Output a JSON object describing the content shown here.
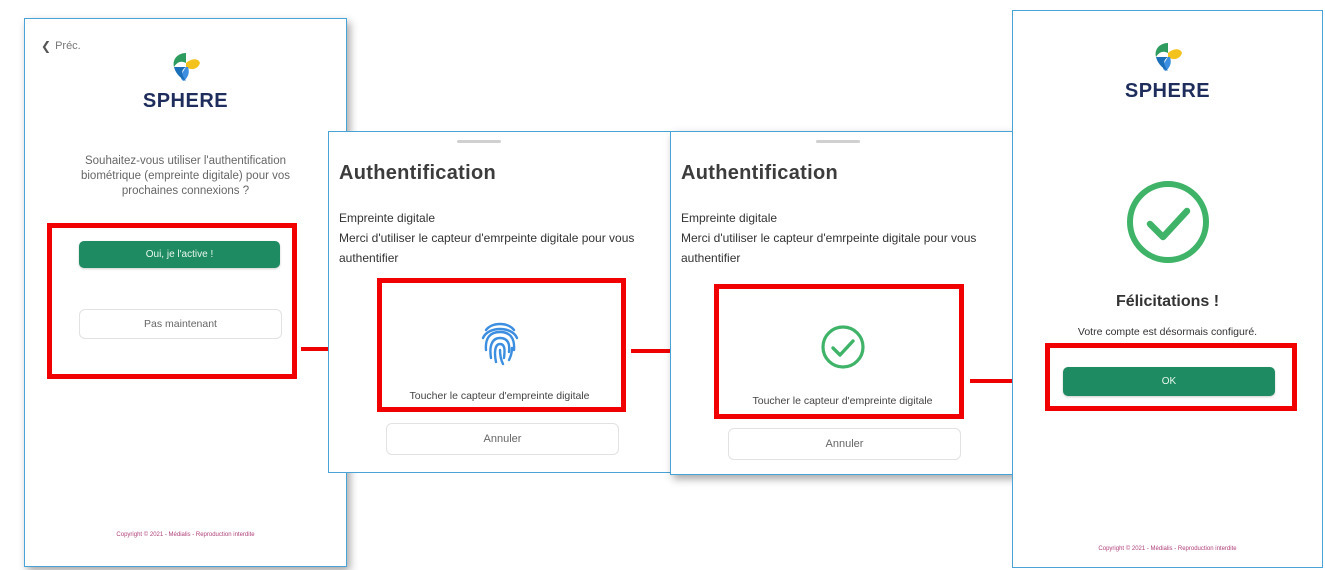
{
  "screen1": {
    "back_label": "Préc.",
    "brand": "SPHERE",
    "question": "Souhaitez-vous utiliser l'authentification biométrique (empreinte digitale) pour vos prochaines connexions ?",
    "primary_button": "Oui, je l'active !",
    "secondary_button": "Pas maintenant",
    "copyright": "Copyright © 2021 - Médialis - Reproduction interdite"
  },
  "screen2": {
    "title": "Authentification",
    "line1": "Empreinte digitale",
    "line2": "Merci d'utiliser le capteur d'emrpeinte digitale pour vous authentifier",
    "touch_label": "Toucher le capteur d'empreinte digitale",
    "cancel_button": "Annuler"
  },
  "screen3": {
    "title": "Authentification",
    "line1": "Empreinte digitale",
    "line2": "Merci d'utiliser le capteur d'emrpeinte digitale pour vous authentifier",
    "touch_label": "Toucher le capteur d'empreinte digitale",
    "cancel_button": "Annuler"
  },
  "screen4": {
    "brand": "SPHERE",
    "heading": "Félicitations !",
    "message": "Votre compte est désormais configuré.",
    "ok_button": "OK",
    "copyright": "Copyright © 2021 - Médialis - Reproduction interdite"
  },
  "colors": {
    "accent_green": "#1f8b62",
    "highlight_red": "#f00000",
    "panel_border": "#4aa3d6",
    "brand_navy": "#1f2d5c",
    "fingerprint_blue": "#3b8ee0"
  },
  "icons": {
    "logo": "sphere-logo",
    "fingerprint": "fingerprint-icon",
    "check": "check-circle-icon",
    "back": "chevron-left-icon"
  }
}
